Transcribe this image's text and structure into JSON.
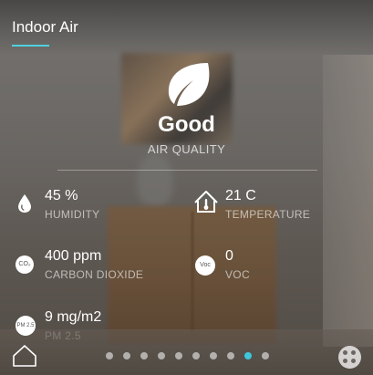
{
  "header": {
    "title": "Indoor Air"
  },
  "status": {
    "label": "Good",
    "sublabel": "AIR QUALITY"
  },
  "metrics": [
    {
      "value": "45 %",
      "label": "HUMIDITY",
      "icon": "water-drop-icon"
    },
    {
      "value": "21 C",
      "label": "TEMPERATURE",
      "icon": "thermometer-home-icon"
    },
    {
      "value": "400 ppm",
      "label": "CARBON DIOXIDE",
      "icon": "co2-icon",
      "badge": "CO₂"
    },
    {
      "value": "0",
      "label": "VOC",
      "icon": "voc-icon",
      "badge": "Voc"
    },
    {
      "value": "9 mg/m2",
      "label": "PM 2.5",
      "icon": "pm25-icon",
      "badge": "PM 2.5"
    }
  ],
  "pager": {
    "count": 10,
    "active": 8
  },
  "colors": {
    "accent": "#3ec6dc",
    "text": "#ffffff"
  }
}
